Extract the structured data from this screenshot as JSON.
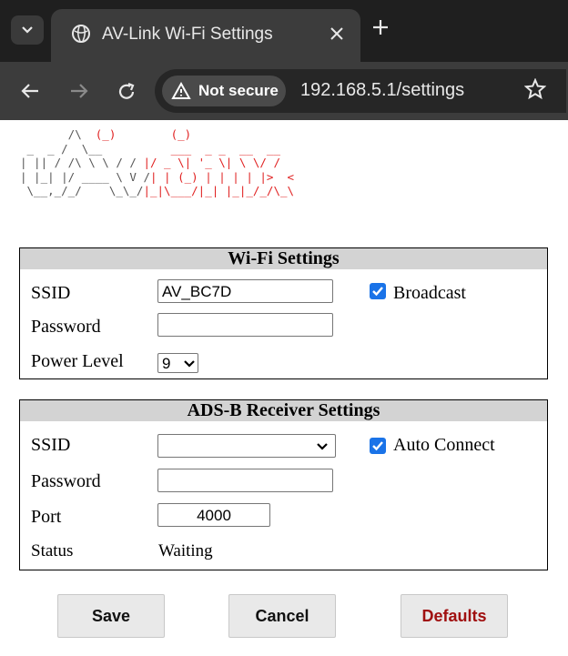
{
  "browser": {
    "tab_title": "AV-Link Wi-Fi Settings",
    "security_chip": "Not secure",
    "url": "192.168.5.1/settings"
  },
  "logo": {
    "lines_left": [
      "       /\\",
      " _  _ /  \\__",
      "| || / /\\ \\ \\ / /",
      "| |_| |/ ____ \\ V /",
      " \\__,_/_/    \\_\\_/"
    ],
    "lines_right": [
      "  (_)        (_)",
      "          ___  _ _  __  __",
      " |/ _ \\| '_ \\| \\ \\/ /",
      "| | (_) | | | | |>  <",
      "|_|\\___/|_| |_|_/_/\\_\\"
    ]
  },
  "wifi": {
    "title": "Wi-Fi Settings",
    "ssid_label": "SSID",
    "ssid_value": "AV_BC7D",
    "broadcast_label": "Broadcast",
    "password_label": "Password",
    "password_value": "",
    "power_label": "Power Level",
    "power_value": "9"
  },
  "adsb": {
    "title": "ADS-B Receiver Settings",
    "ssid_label": "SSID",
    "ssid_value": "",
    "auto_connect_label": "Auto Connect",
    "password_label": "Password",
    "password_value": "",
    "port_label": "Port",
    "port_value": "4000",
    "status_label": "Status",
    "status_value": "Waiting"
  },
  "buttons": {
    "save": "Save",
    "cancel": "Cancel",
    "defaults": "Defaults"
  },
  "colors": {
    "defaults_text": "#a01010",
    "logo_red": "#e02020",
    "checkbox": "#1a73e8"
  }
}
